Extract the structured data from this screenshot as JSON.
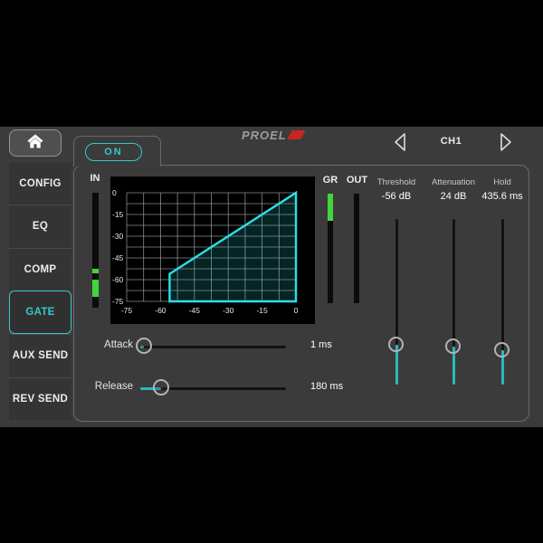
{
  "accent_color": "#35c8cd",
  "meter_green": "#41d53a",
  "topbar": {
    "logo_text": "PROEL",
    "on_label": "ON",
    "channel": "CH1"
  },
  "sidebar": {
    "selected_index": 3,
    "items": [
      {
        "label": "CONFIG"
      },
      {
        "label": "EQ"
      },
      {
        "label": "COMP"
      },
      {
        "label": "GATE"
      },
      {
        "label": "AUX SEND"
      },
      {
        "label": "REV SEND"
      }
    ]
  },
  "meters": {
    "in": {
      "label": "IN",
      "segments": [
        {
          "from": 0.66,
          "to": 0.705
        },
        {
          "from": 0.755,
          "to": 0.905
        }
      ]
    },
    "gr": {
      "label": "GR",
      "segments": [
        {
          "from": 0.0,
          "to": 0.25
        }
      ]
    },
    "out": {
      "label": "OUT",
      "segments": []
    }
  },
  "faders": [
    {
      "label": "Threshold",
      "value": "-56 dB",
      "knob_frac": 0.757
    },
    {
      "label": "Attenuation",
      "value": "24 dB",
      "knob_frac": 0.768
    },
    {
      "label": "Hold",
      "value": "435.6 ms",
      "knob_frac": 0.792
    }
  ],
  "sliders": [
    {
      "label": "Attack",
      "value": "1 ms",
      "fill_frac": 0.025
    },
    {
      "label": "Release",
      "value": "180 ms",
      "fill_frac": 0.143
    }
  ],
  "chart_data": {
    "type": "area",
    "title": "",
    "xlabel": "",
    "ylabel": "",
    "xlim": [
      -75,
      0
    ],
    "ylim": [
      -75,
      0
    ],
    "grid": true,
    "grid_step": 7.5,
    "xticks": [
      -75,
      -60,
      -45,
      -30,
      -15,
      0
    ],
    "yticks": [
      0,
      -15,
      -30,
      -45,
      -60,
      -75
    ],
    "curve_polygon": [
      [
        -56,
        -75
      ],
      [
        -56,
        -56
      ],
      [
        0,
        0
      ],
      [
        0,
        -75
      ]
    ],
    "colors": {
      "bg": "#000000",
      "grid": "#9a9a9a",
      "stroke": "#2be0e8",
      "fill": "rgba(43,224,232,0.16)",
      "tick_text": "#e8e8e8"
    }
  }
}
